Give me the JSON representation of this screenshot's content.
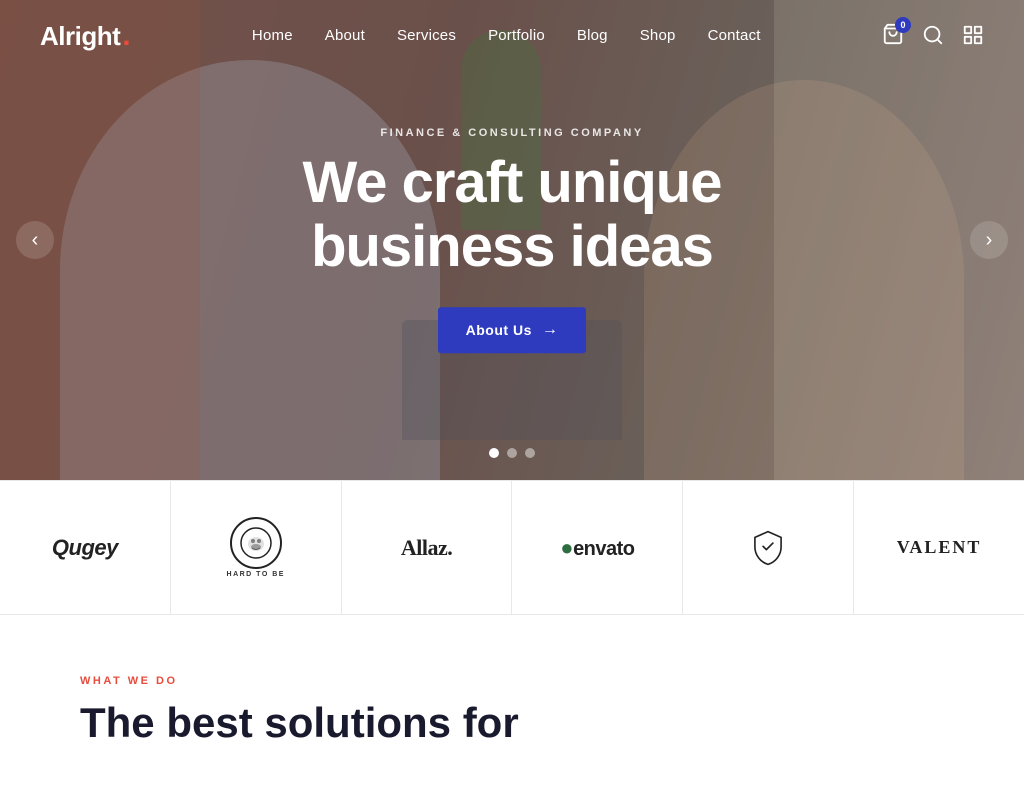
{
  "brand": {
    "name": "Alright",
    "dot": "."
  },
  "nav": {
    "items": [
      {
        "label": "Home",
        "href": "#"
      },
      {
        "label": "About",
        "href": "#"
      },
      {
        "label": "Services",
        "href": "#"
      },
      {
        "label": "Portfolio",
        "href": "#"
      },
      {
        "label": "Blog",
        "href": "#"
      },
      {
        "label": "Shop",
        "href": "#"
      },
      {
        "label": "Contact",
        "href": "#"
      }
    ]
  },
  "cart": {
    "badge": "0"
  },
  "hero": {
    "subtitle": "Finance & Consulting Company",
    "title_line1": "We craft unique",
    "title_line2": "business ideas",
    "btn_label": "About Us",
    "dots": [
      {
        "active": true
      },
      {
        "active": false
      },
      {
        "active": false
      }
    ]
  },
  "logos": [
    {
      "id": "qugey",
      "text": "Qugey",
      "type": "text"
    },
    {
      "id": "bulldog",
      "text": "Bulldog",
      "type": "bulldog"
    },
    {
      "id": "allaz",
      "text": "Allaz.",
      "type": "text"
    },
    {
      "id": "envato",
      "text": "envato",
      "type": "envato"
    },
    {
      "id": "shield",
      "text": "",
      "type": "shield"
    },
    {
      "id": "valent",
      "text": "VALENT",
      "type": "text"
    }
  ],
  "what_we_do": {
    "tag": "What We Do",
    "title_line1": "The best solutions for"
  }
}
